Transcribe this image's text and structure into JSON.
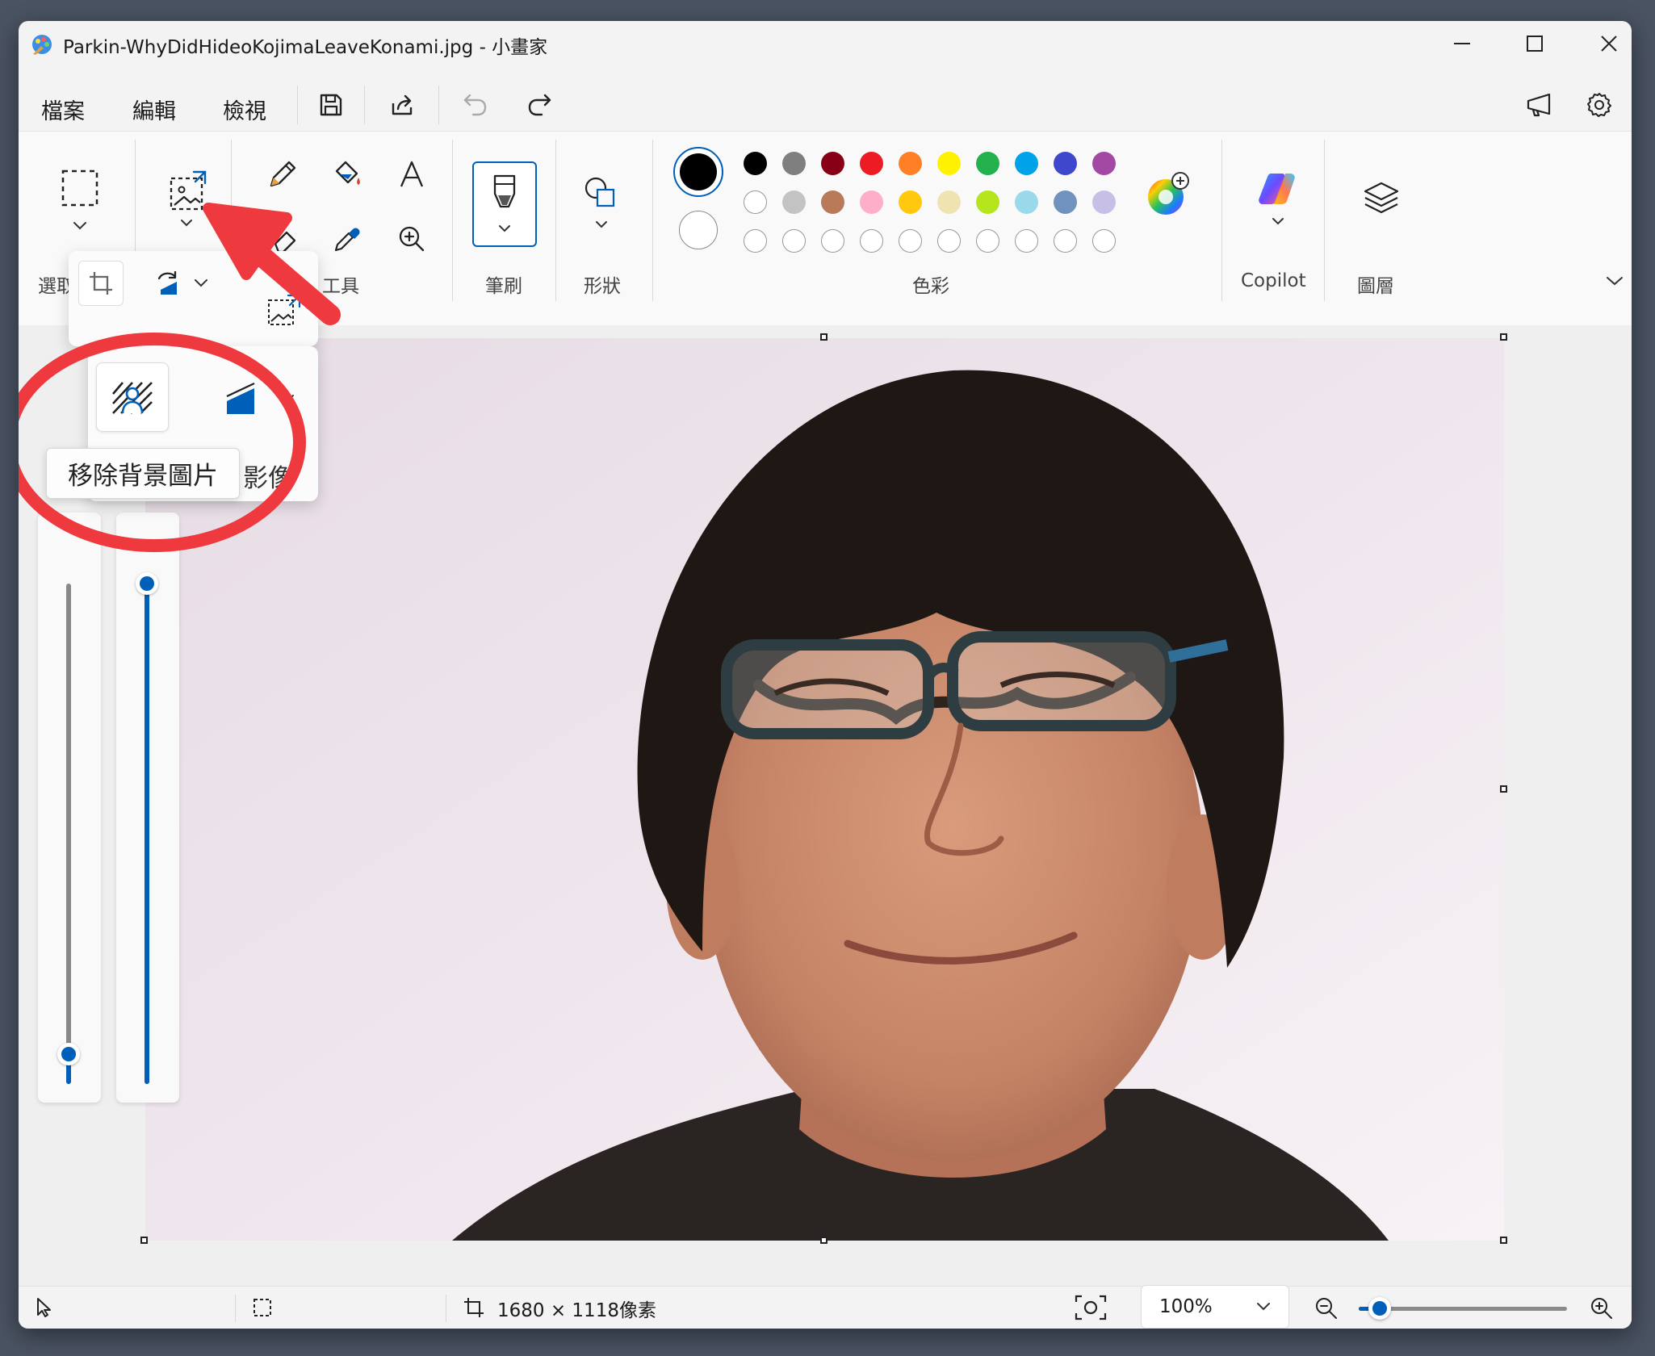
{
  "window": {
    "title": "Parkin-WhyDidHideoKojimaLeaveKonami.jpg - 小畫家"
  },
  "menu": {
    "file": "檔案",
    "edit": "編輯",
    "view": "檢視"
  },
  "ribbon": {
    "selection_label": "選取",
    "tools_label": "工具",
    "brushes_label": "筆刷",
    "shapes_label": "形狀",
    "colors_label": "色彩",
    "copilot_label": "Copilot",
    "layers_label": "圖層"
  },
  "image_menu": {
    "label": "影像",
    "tooltip": "移除背景圖片"
  },
  "colors": {
    "primary": "#000000",
    "secondary": "#ffffff",
    "palette_row1": [
      "#000000",
      "#7f7f7f",
      "#880015",
      "#ed1c24",
      "#ff7f27",
      "#fff200",
      "#22b14c",
      "#00a2e8",
      "#3f48cc",
      "#a349a4"
    ],
    "palette_row2": [
      "#ffffff",
      "#c3c3c3",
      "#b97a57",
      "#ffaec9",
      "#ffc90e",
      "#efe4b0",
      "#b5e61d",
      "#99d9ea",
      "#7092be",
      "#c8bfe7"
    ],
    "accent": "#005fb8",
    "annotation_red": "#ee3a3f"
  },
  "sliders": {
    "size_level": 0.03,
    "opacity_level": 1.0
  },
  "status": {
    "dimensions": "1680 × 1118像素",
    "zoom": "100%",
    "zoom_slider_level": 0.1
  }
}
